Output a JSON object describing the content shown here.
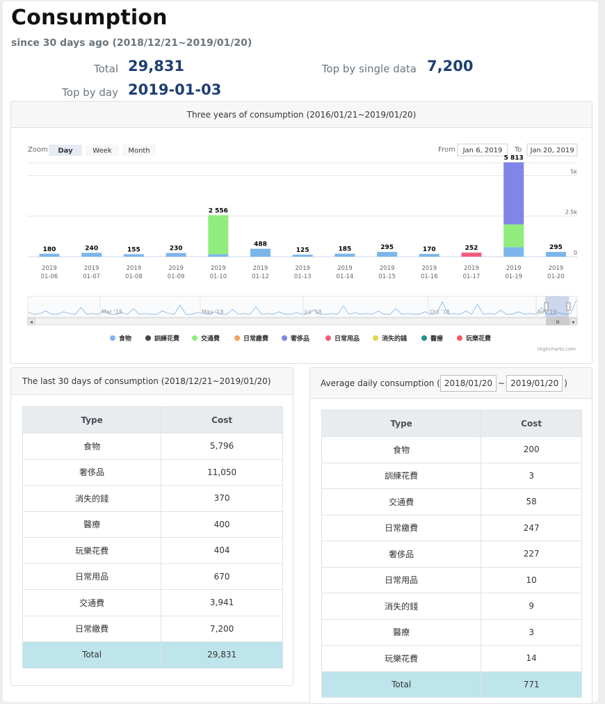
{
  "header": {
    "title": "Consumption",
    "subtitle": "since 30 days ago (2018/12/21~2019/01/20)"
  },
  "stats": {
    "total_label": "Total",
    "total_value": "29,831",
    "top_single_label": "Top by single data",
    "top_single_value": "7,200",
    "top_day_label": "Top by day",
    "top_day_value": "2019-01-03"
  },
  "chart_card": {
    "title": "Three years of consumption (2016/01/21~2019/01/20)",
    "zoom_label": "Zoom",
    "zoom_buttons": [
      "Day",
      "Week",
      "Month"
    ],
    "zoom_selected": "Day",
    "from_label": "From",
    "from_value": "Jan 6, 2019",
    "to_label": "To",
    "to_value": "Jan 20, 2019",
    "credit": "Highcharts.com"
  },
  "chart_data": {
    "type": "bar",
    "stacked": true,
    "categories": [
      "2019 01-06",
      "2019 01-07",
      "2019 01-08",
      "2019 01-09",
      "2019 01-10",
      "2019 01-12",
      "2019 01-13",
      "2019 01-14",
      "2019 01-15",
      "2019 01-16",
      "2019 01-17",
      "2019 01-19",
      "2019 01-20"
    ],
    "totals": [
      "180",
      "240",
      "155",
      "230",
      "2 556",
      "488",
      "125",
      "185",
      "295",
      "170",
      "252",
      "5 813",
      "295"
    ],
    "series": [
      {
        "name": "食物",
        "color": "#7cb5ec",
        "values": [
          180,
          240,
          155,
          230,
          156,
          488,
          125,
          185,
          295,
          170,
          0,
          590,
          295
        ]
      },
      {
        "name": "訓練花費",
        "color": "#434348",
        "values": [
          0,
          0,
          0,
          0,
          0,
          0,
          0,
          0,
          0,
          0,
          0,
          0,
          0
        ]
      },
      {
        "name": "交通費",
        "color": "#90ed7d",
        "values": [
          0,
          0,
          0,
          0,
          2400,
          0,
          0,
          0,
          0,
          0,
          0,
          1400,
          0
        ]
      },
      {
        "name": "日常繳費",
        "color": "#f7a35c",
        "values": [
          0,
          0,
          0,
          0,
          0,
          0,
          0,
          0,
          0,
          0,
          0,
          0,
          0
        ]
      },
      {
        "name": "奢侈品",
        "color": "#8085e9",
        "values": [
          0,
          0,
          0,
          0,
          0,
          0,
          0,
          0,
          0,
          0,
          0,
          3823,
          0
        ]
      },
      {
        "name": "日常用品",
        "color": "#f15c80",
        "values": [
          0,
          0,
          0,
          0,
          0,
          0,
          0,
          0,
          0,
          0,
          252,
          0,
          0
        ]
      },
      {
        "name": "消失的錢",
        "color": "#e4d354",
        "values": [
          0,
          0,
          0,
          0,
          0,
          0,
          0,
          0,
          0,
          0,
          0,
          0,
          0
        ]
      },
      {
        "name": "醫療",
        "color": "#2b908f",
        "values": [
          0,
          0,
          0,
          0,
          0,
          0,
          0,
          0,
          0,
          0,
          0,
          0,
          0
        ]
      },
      {
        "name": "玩樂花費",
        "color": "#f45b5b",
        "values": [
          0,
          0,
          0,
          0,
          0,
          0,
          0,
          0,
          0,
          0,
          0,
          0,
          0
        ]
      }
    ],
    "y_ticks": [
      "0",
      "2.5k",
      "5k"
    ],
    "ylim": [
      0,
      6000
    ],
    "y_axis_side": "right",
    "navigator_labels": [
      "Mar '18",
      "May '18",
      "Jul '18",
      "Oct '18",
      "Jan '19"
    ],
    "legend_position": "bottom"
  },
  "last30": {
    "title": "The last 30 days of consumption (2018/12/21~2019/01/20)",
    "columns": [
      "Type",
      "Cost"
    ],
    "rows": [
      [
        "食物",
        "5,796"
      ],
      [
        "奢侈品",
        "11,050"
      ],
      [
        "消失的錢",
        "370"
      ],
      [
        "醫療",
        "400"
      ],
      [
        "玩樂花費",
        "404"
      ],
      [
        "日常用品",
        "670"
      ],
      [
        "交通費",
        "3,941"
      ],
      [
        "日常繳費",
        "7,200"
      ]
    ],
    "total": [
      "Total",
      "29,831"
    ]
  },
  "average": {
    "title_prefix": "Average daily consumption (",
    "from": "2018/01/20",
    "sep": "~",
    "to": "2019/01/20",
    "title_suffix": ")",
    "columns": [
      "Type",
      "Cost"
    ],
    "rows": [
      [
        "食物",
        "200"
      ],
      [
        "訓練花費",
        "3"
      ],
      [
        "交通費",
        "58"
      ],
      [
        "日常繳費",
        "247"
      ],
      [
        "奢侈品",
        "227"
      ],
      [
        "日常用品",
        "10"
      ],
      [
        "消失的錢",
        "9"
      ],
      [
        "醫療",
        "3"
      ],
      [
        "玩樂花費",
        "14"
      ]
    ],
    "total": [
      "Total",
      "771"
    ]
  }
}
